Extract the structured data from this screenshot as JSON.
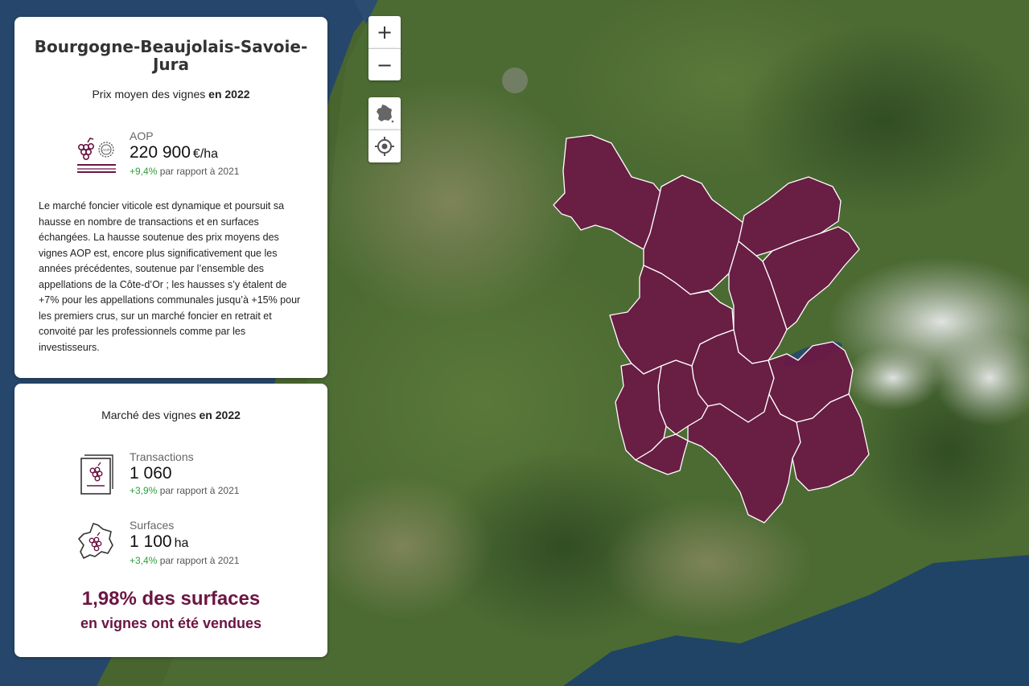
{
  "map": {
    "colors": {
      "region_fill": "#6b1a45",
      "region_border": "#ffffff",
      "accent": "#6b1542",
      "positive": "#2e9e3b"
    },
    "controls": {
      "zoom_in": "+",
      "zoom_out": "−",
      "france_icon": "france-map-icon",
      "locate_icon": "crosshair-icon"
    }
  },
  "price_panel": {
    "region": "Bourgogne-Beaujolais-Savoie-Jura",
    "subtitle_prefix": "Prix moyen des vignes",
    "subtitle_year": "en 2022",
    "aop": {
      "label": "AOP",
      "value": "220 900",
      "unit": "€/ha",
      "delta_pct": "+9,4%",
      "delta_text": "par rapport à 2021",
      "icon": "aop-grapes-icon"
    },
    "description": "Le marché foncier viticole est dynamique et poursuit sa hausse en nombre de transactions et en surfaces échangées. La hausse soutenue des prix moyens des vignes AOP est, encore plus significativement que les années précédentes, soutenue par l’ensemble des appellations de la Côte-d’Or ; les hausses s’y étalent de +7% pour les appellations communales jusqu’à +15% pour les premiers crus, sur un marché foncier en retrait et convoité par les professionnels comme par les investisseurs."
  },
  "market_panel": {
    "subtitle_prefix": "Marché des vignes",
    "subtitle_year": "en 2022",
    "transactions": {
      "label": "Transactions",
      "value": "1 060",
      "delta_pct": "+3,9%",
      "delta_text": "par rapport à 2021",
      "icon": "document-grapes-icon"
    },
    "surfaces": {
      "label": "Surfaces",
      "value": "1 100",
      "unit": "ha",
      "delta_pct": "+3,4%",
      "delta_text": "par rapport à 2021",
      "icon": "france-grapes-icon"
    },
    "highlight_line1": "1,98% des surfaces",
    "highlight_line2": "en vignes ont été vendues"
  }
}
